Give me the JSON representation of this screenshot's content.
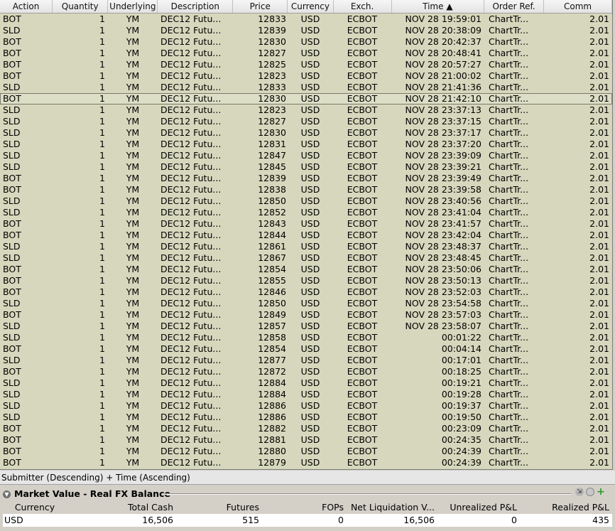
{
  "columns": [
    "Action",
    "Quantity",
    "Underlying",
    "Description",
    "Price",
    "Currency",
    "Exch.",
    "Time",
    "Order Ref.",
    "Comm"
  ],
  "sort_arrow": "▲",
  "trades": [
    {
      "action": "BOT",
      "qty": "1",
      "und": "YM",
      "desc": "DEC12 Futu...",
      "price": "12833",
      "cur": "USD",
      "exch": "ECBOT",
      "time": "NOV 28 19:59:01",
      "ref": "ChartTr...",
      "comm": "2.01"
    },
    {
      "action": "SLD",
      "qty": "1",
      "und": "YM",
      "desc": "DEC12 Futu...",
      "price": "12839",
      "cur": "USD",
      "exch": "ECBOT",
      "time": "NOV 28 20:38:09",
      "ref": "ChartTr...",
      "comm": "2.01"
    },
    {
      "action": "BOT",
      "qty": "1",
      "und": "YM",
      "desc": "DEC12 Futu...",
      "price": "12830",
      "cur": "USD",
      "exch": "ECBOT",
      "time": "NOV 28 20:42:37",
      "ref": "ChartTr...",
      "comm": "2.01"
    },
    {
      "action": "BOT",
      "qty": "1",
      "und": "YM",
      "desc": "DEC12 Futu...",
      "price": "12827",
      "cur": "USD",
      "exch": "ECBOT",
      "time": "NOV 28 20:48:41",
      "ref": "ChartTr...",
      "comm": "2.01"
    },
    {
      "action": "BOT",
      "qty": "1",
      "und": "YM",
      "desc": "DEC12 Futu...",
      "price": "12825",
      "cur": "USD",
      "exch": "ECBOT",
      "time": "NOV 28 20:57:27",
      "ref": "ChartTr...",
      "comm": "2.01"
    },
    {
      "action": "BOT",
      "qty": "1",
      "und": "YM",
      "desc": "DEC12 Futu...",
      "price": "12823",
      "cur": "USD",
      "exch": "ECBOT",
      "time": "NOV 28 21:00:02",
      "ref": "ChartTr...",
      "comm": "2.01"
    },
    {
      "action": "SLD",
      "qty": "1",
      "und": "YM",
      "desc": "DEC12 Futu...",
      "price": "12833",
      "cur": "USD",
      "exch": "ECBOT",
      "time": "NOV 28 21:41:36",
      "ref": "ChartTr...",
      "comm": "2.01"
    },
    {
      "action": "BOT",
      "qty": "1",
      "und": "YM",
      "desc": "DEC12 Futu...",
      "price": "12830",
      "cur": "USD",
      "exch": "ECBOT",
      "time": "NOV 28 21:42:10",
      "ref": "ChartTr...",
      "comm": "2.01",
      "selected": true
    },
    {
      "action": "SLD",
      "qty": "1",
      "und": "YM",
      "desc": "DEC12 Futu...",
      "price": "12823",
      "cur": "USD",
      "exch": "ECBOT",
      "time": "NOV 28 23:37:13",
      "ref": "ChartTr...",
      "comm": "2.01"
    },
    {
      "action": "SLD",
      "qty": "1",
      "und": "YM",
      "desc": "DEC12 Futu...",
      "price": "12827",
      "cur": "USD",
      "exch": "ECBOT",
      "time": "NOV 28 23:37:15",
      "ref": "ChartTr...",
      "comm": "2.01"
    },
    {
      "action": "SLD",
      "qty": "1",
      "und": "YM",
      "desc": "DEC12 Futu...",
      "price": "12830",
      "cur": "USD",
      "exch": "ECBOT",
      "time": "NOV 28 23:37:17",
      "ref": "ChartTr...",
      "comm": "2.01"
    },
    {
      "action": "SLD",
      "qty": "1",
      "und": "YM",
      "desc": "DEC12 Futu...",
      "price": "12831",
      "cur": "USD",
      "exch": "ECBOT",
      "time": "NOV 28 23:37:20",
      "ref": "ChartTr...",
      "comm": "2.01"
    },
    {
      "action": "SLD",
      "qty": "1",
      "und": "YM",
      "desc": "DEC12 Futu...",
      "price": "12847",
      "cur": "USD",
      "exch": "ECBOT",
      "time": "NOV 28 23:39:09",
      "ref": "ChartTr...",
      "comm": "2.01"
    },
    {
      "action": "SLD",
      "qty": "1",
      "und": "YM",
      "desc": "DEC12 Futu...",
      "price": "12845",
      "cur": "USD",
      "exch": "ECBOT",
      "time": "NOV 28 23:39:21",
      "ref": "ChartTr...",
      "comm": "2.01"
    },
    {
      "action": "BOT",
      "qty": "1",
      "und": "YM",
      "desc": "DEC12 Futu...",
      "price": "12839",
      "cur": "USD",
      "exch": "ECBOT",
      "time": "NOV 28 23:39:49",
      "ref": "ChartTr...",
      "comm": "2.01"
    },
    {
      "action": "BOT",
      "qty": "1",
      "und": "YM",
      "desc": "DEC12 Futu...",
      "price": "12838",
      "cur": "USD",
      "exch": "ECBOT",
      "time": "NOV 28 23:39:58",
      "ref": "ChartTr...",
      "comm": "2.01"
    },
    {
      "action": "SLD",
      "qty": "1",
      "und": "YM",
      "desc": "DEC12 Futu...",
      "price": "12850",
      "cur": "USD",
      "exch": "ECBOT",
      "time": "NOV 28 23:40:56",
      "ref": "ChartTr...",
      "comm": "2.01"
    },
    {
      "action": "SLD",
      "qty": "1",
      "und": "YM",
      "desc": "DEC12 Futu...",
      "price": "12852",
      "cur": "USD",
      "exch": "ECBOT",
      "time": "NOV 28 23:41:04",
      "ref": "ChartTr...",
      "comm": "2.01"
    },
    {
      "action": "BOT",
      "qty": "1",
      "und": "YM",
      "desc": "DEC12 Futu...",
      "price": "12843",
      "cur": "USD",
      "exch": "ECBOT",
      "time": "NOV 28 23:41:57",
      "ref": "ChartTr...",
      "comm": "2.01"
    },
    {
      "action": "BOT",
      "qty": "1",
      "und": "YM",
      "desc": "DEC12 Futu...",
      "price": "12844",
      "cur": "USD",
      "exch": "ECBOT",
      "time": "NOV 28 23:42:04",
      "ref": "ChartTr...",
      "comm": "2.01"
    },
    {
      "action": "SLD",
      "qty": "1",
      "und": "YM",
      "desc": "DEC12 Futu...",
      "price": "12861",
      "cur": "USD",
      "exch": "ECBOT",
      "time": "NOV 28 23:48:37",
      "ref": "ChartTr...",
      "comm": "2.01"
    },
    {
      "action": "SLD",
      "qty": "1",
      "und": "YM",
      "desc": "DEC12 Futu...",
      "price": "12867",
      "cur": "USD",
      "exch": "ECBOT",
      "time": "NOV 28 23:48:45",
      "ref": "ChartTr...",
      "comm": "2.01"
    },
    {
      "action": "BOT",
      "qty": "1",
      "und": "YM",
      "desc": "DEC12 Futu...",
      "price": "12854",
      "cur": "USD",
      "exch": "ECBOT",
      "time": "NOV 28 23:50:06",
      "ref": "ChartTr...",
      "comm": "2.01"
    },
    {
      "action": "BOT",
      "qty": "1",
      "und": "YM",
      "desc": "DEC12 Futu...",
      "price": "12855",
      "cur": "USD",
      "exch": "ECBOT",
      "time": "NOV 28 23:50:13",
      "ref": "ChartTr...",
      "comm": "2.01"
    },
    {
      "action": "BOT",
      "qty": "1",
      "und": "YM",
      "desc": "DEC12 Futu...",
      "price": "12846",
      "cur": "USD",
      "exch": "ECBOT",
      "time": "NOV 28 23:52:03",
      "ref": "ChartTr...",
      "comm": "2.01"
    },
    {
      "action": "SLD",
      "qty": "1",
      "und": "YM",
      "desc": "DEC12 Futu...",
      "price": "12850",
      "cur": "USD",
      "exch": "ECBOT",
      "time": "NOV 28 23:54:58",
      "ref": "ChartTr...",
      "comm": "2.01"
    },
    {
      "action": "BOT",
      "qty": "1",
      "und": "YM",
      "desc": "DEC12 Futu...",
      "price": "12849",
      "cur": "USD",
      "exch": "ECBOT",
      "time": "NOV 28 23:57:03",
      "ref": "ChartTr...",
      "comm": "2.01"
    },
    {
      "action": "SLD",
      "qty": "1",
      "und": "YM",
      "desc": "DEC12 Futu...",
      "price": "12857",
      "cur": "USD",
      "exch": "ECBOT",
      "time": "NOV 28 23:58:07",
      "ref": "ChartTr...",
      "comm": "2.01"
    },
    {
      "action": "SLD",
      "qty": "1",
      "und": "YM",
      "desc": "DEC12 Futu...",
      "price": "12858",
      "cur": "USD",
      "exch": "ECBOT",
      "time": "00:01:22",
      "ref": "ChartTr...",
      "comm": "2.01"
    },
    {
      "action": "BOT",
      "qty": "1",
      "und": "YM",
      "desc": "DEC12 Futu...",
      "price": "12854",
      "cur": "USD",
      "exch": "ECBOT",
      "time": "00:04:14",
      "ref": "ChartTr...",
      "comm": "2.01"
    },
    {
      "action": "SLD",
      "qty": "1",
      "und": "YM",
      "desc": "DEC12 Futu...",
      "price": "12877",
      "cur": "USD",
      "exch": "ECBOT",
      "time": "00:17:01",
      "ref": "ChartTr...",
      "comm": "2.01"
    },
    {
      "action": "BOT",
      "qty": "1",
      "und": "YM",
      "desc": "DEC12 Futu...",
      "price": "12872",
      "cur": "USD",
      "exch": "ECBOT",
      "time": "00:18:25",
      "ref": "ChartTr...",
      "comm": "2.01"
    },
    {
      "action": "SLD",
      "qty": "1",
      "und": "YM",
      "desc": "DEC12 Futu...",
      "price": "12884",
      "cur": "USD",
      "exch": "ECBOT",
      "time": "00:19:21",
      "ref": "ChartTr...",
      "comm": "2.01"
    },
    {
      "action": "SLD",
      "qty": "1",
      "und": "YM",
      "desc": "DEC12 Futu...",
      "price": "12884",
      "cur": "USD",
      "exch": "ECBOT",
      "time": "00:19:28",
      "ref": "ChartTr...",
      "comm": "2.01"
    },
    {
      "action": "SLD",
      "qty": "1",
      "und": "YM",
      "desc": "DEC12 Futu...",
      "price": "12886",
      "cur": "USD",
      "exch": "ECBOT",
      "time": "00:19:37",
      "ref": "ChartTr...",
      "comm": "2.01"
    },
    {
      "action": "SLD",
      "qty": "1",
      "und": "YM",
      "desc": "DEC12 Futu...",
      "price": "12886",
      "cur": "USD",
      "exch": "ECBOT",
      "time": "00:19:50",
      "ref": "ChartTr...",
      "comm": "2.01"
    },
    {
      "action": "BOT",
      "qty": "1",
      "und": "YM",
      "desc": "DEC12 Futu...",
      "price": "12882",
      "cur": "USD",
      "exch": "ECBOT",
      "time": "00:23:09",
      "ref": "ChartTr...",
      "comm": "2.01"
    },
    {
      "action": "BOT",
      "qty": "1",
      "und": "YM",
      "desc": "DEC12 Futu...",
      "price": "12881",
      "cur": "USD",
      "exch": "ECBOT",
      "time": "00:24:35",
      "ref": "ChartTr...",
      "comm": "2.01"
    },
    {
      "action": "BOT",
      "qty": "1",
      "und": "YM",
      "desc": "DEC12 Futu...",
      "price": "12880",
      "cur": "USD",
      "exch": "ECBOT",
      "time": "00:24:39",
      "ref": "ChartTr...",
      "comm": "2.01"
    },
    {
      "action": "BOT",
      "qty": "1",
      "und": "YM",
      "desc": "DEC12 Futu...",
      "price": "12879",
      "cur": "USD",
      "exch": "ECBOT",
      "time": "00:24:39",
      "ref": "ChartTr...",
      "comm": "2.01"
    }
  ],
  "sort_status": "Submitter (Descending)  +  Time (Ascending)",
  "market_value": {
    "title": "Market Value - Real FX Balance",
    "columns": [
      "Currency",
      "Total Cash",
      "Futures",
      "FOPs",
      "Net Liquidation V...",
      "Unrealized P&L",
      "Realized P&L"
    ],
    "row": [
      "USD",
      "16,506",
      "515",
      "0",
      "16,506",
      "0",
      "435"
    ]
  },
  "colors": {
    "row_bg": "#d6d7bc",
    "panel_bg": "#d4d0c8",
    "add_icon": "#2a9a2a"
  }
}
